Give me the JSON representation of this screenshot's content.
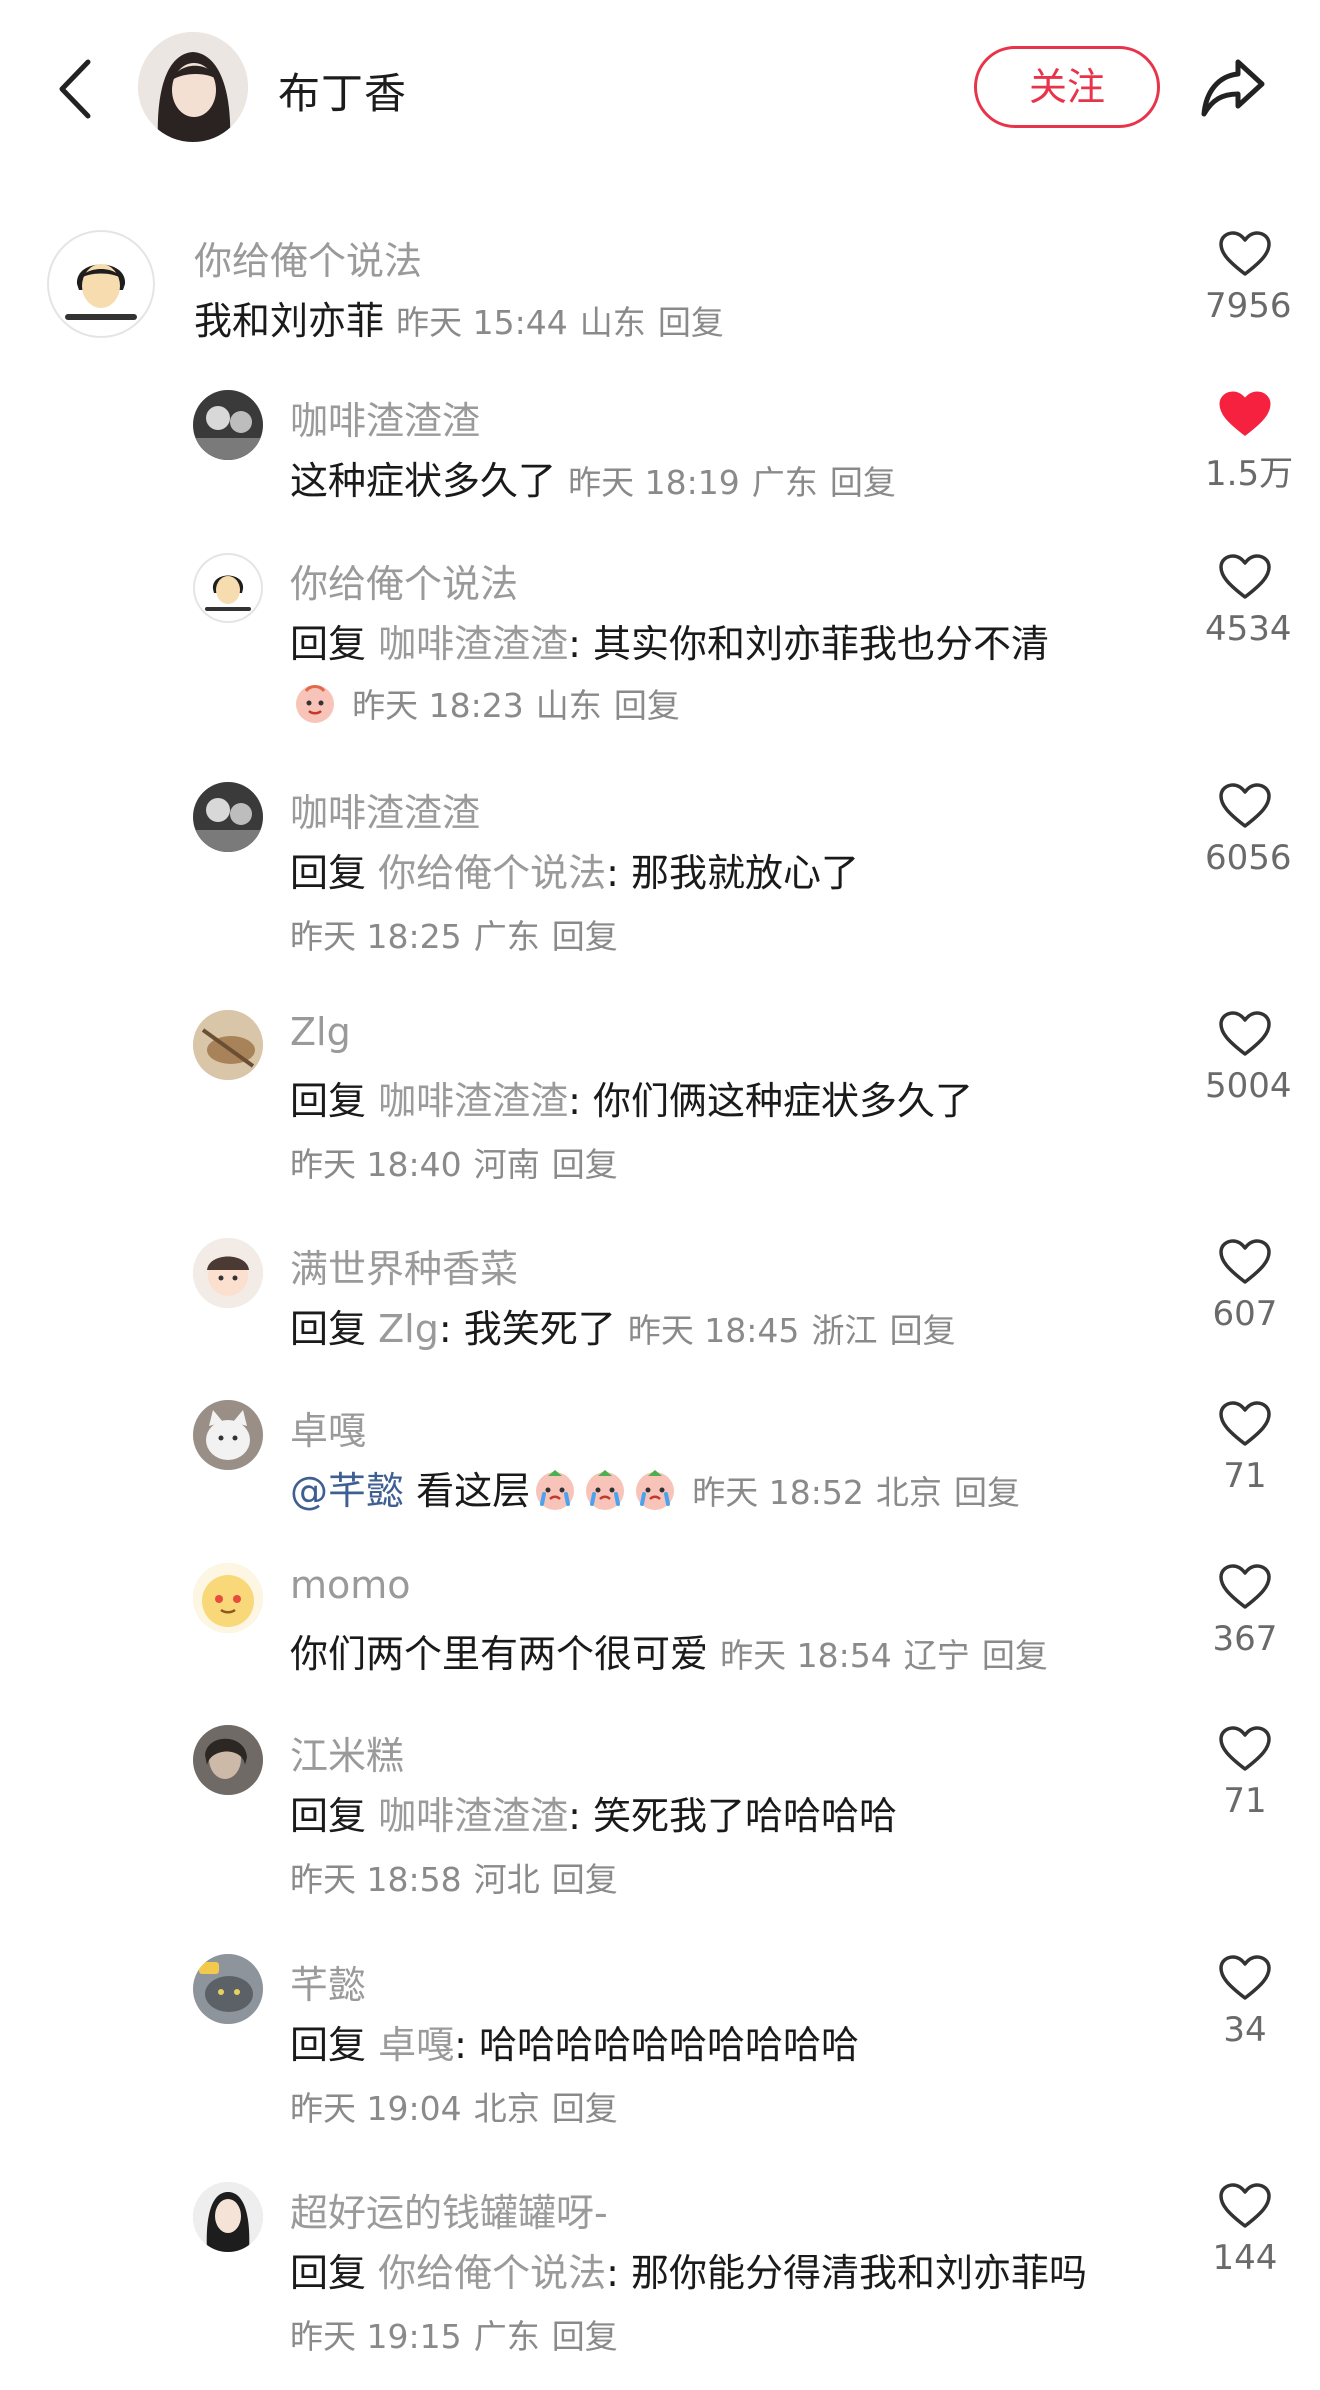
{
  "header": {
    "name": "布丁香",
    "follow_label": "关注"
  },
  "comments": [
    {
      "user": "你给俺个说法",
      "text": "我和刘亦菲",
      "time": "昨天 15:44",
      "loc": "山东",
      "reply": "回复",
      "likes": "7956",
      "liked": false
    },
    {
      "user": "咖啡渣渣渣",
      "text": "这种症状多久了",
      "time": "昨天 18:19",
      "loc": "广东",
      "reply": "回复",
      "likes": "1.5万",
      "liked": true
    },
    {
      "user": "你给俺个说法",
      "reply_prefix": "回复",
      "reply_to": "咖啡渣渣渣",
      "text": ": 其实你和刘亦菲我也分不清",
      "time": "昨天 18:23",
      "loc": "山东",
      "reply": "回复",
      "likes": "4534",
      "liked": false
    },
    {
      "user": "咖啡渣渣渣",
      "reply_prefix": "回复",
      "reply_to": "你给俺个说法",
      "text": ": 那我就放心了",
      "time": "昨天 18:25",
      "loc": "广东",
      "reply": "回复",
      "likes": "6056",
      "liked": false
    },
    {
      "user": "Zlg",
      "reply_prefix": "回复",
      "reply_to": "咖啡渣渣渣",
      "text": ": 你们俩这种症状多久了",
      "time": "昨天 18:40",
      "loc": "河南",
      "reply": "回复",
      "likes": "5004",
      "liked": false
    },
    {
      "user": "满世界种香菜",
      "reply_prefix": "回复",
      "reply_to": "Zlg",
      "text": ": 我笑死了",
      "time": "昨天 18:45",
      "loc": "浙江",
      "reply": "回复",
      "likes": "607",
      "liked": false
    },
    {
      "user": "卓嘎",
      "mention": "@芊懿",
      "text": "看这层",
      "time": "昨天 18:52",
      "loc": "北京",
      "reply": "回复",
      "likes": "71",
      "liked": false
    },
    {
      "user": "momo",
      "text": "你们两个里有两个很可爱",
      "time": "昨天 18:54",
      "loc": "辽宁",
      "reply": "回复",
      "likes": "367",
      "liked": false
    },
    {
      "user": "江米糕",
      "reply_prefix": "回复",
      "reply_to": "咖啡渣渣渣",
      "text": ": 笑死我了哈哈哈哈",
      "time": "昨天 18:58",
      "loc": "河北",
      "reply": "回复",
      "likes": "71",
      "liked": false
    },
    {
      "user": "芊懿",
      "reply_prefix": "回复",
      "reply_to": "卓嘎",
      "text": ": 哈哈哈哈哈哈哈哈哈哈",
      "time": "昨天 19:04",
      "loc": "北京",
      "reply": "回复",
      "likes": "34",
      "liked": false
    },
    {
      "user": "超好运的钱罐罐呀-",
      "reply_prefix": "回复",
      "reply_to": "你给俺个说法",
      "text": ": 那你能分得清我和刘亦菲吗",
      "time": "昨天 19:15",
      "loc": "广东",
      "reply": "回复",
      "likes": "144",
      "liked": false
    }
  ],
  "icons": {
    "heart": "heart-icon",
    "heart_filled": "heart-filled-icon",
    "back": "back-arrow-icon",
    "share": "share-icon"
  },
  "colors": {
    "accent": "#e8344a",
    "mention": "#3f5f93",
    "muted": "#9a9a9a"
  }
}
